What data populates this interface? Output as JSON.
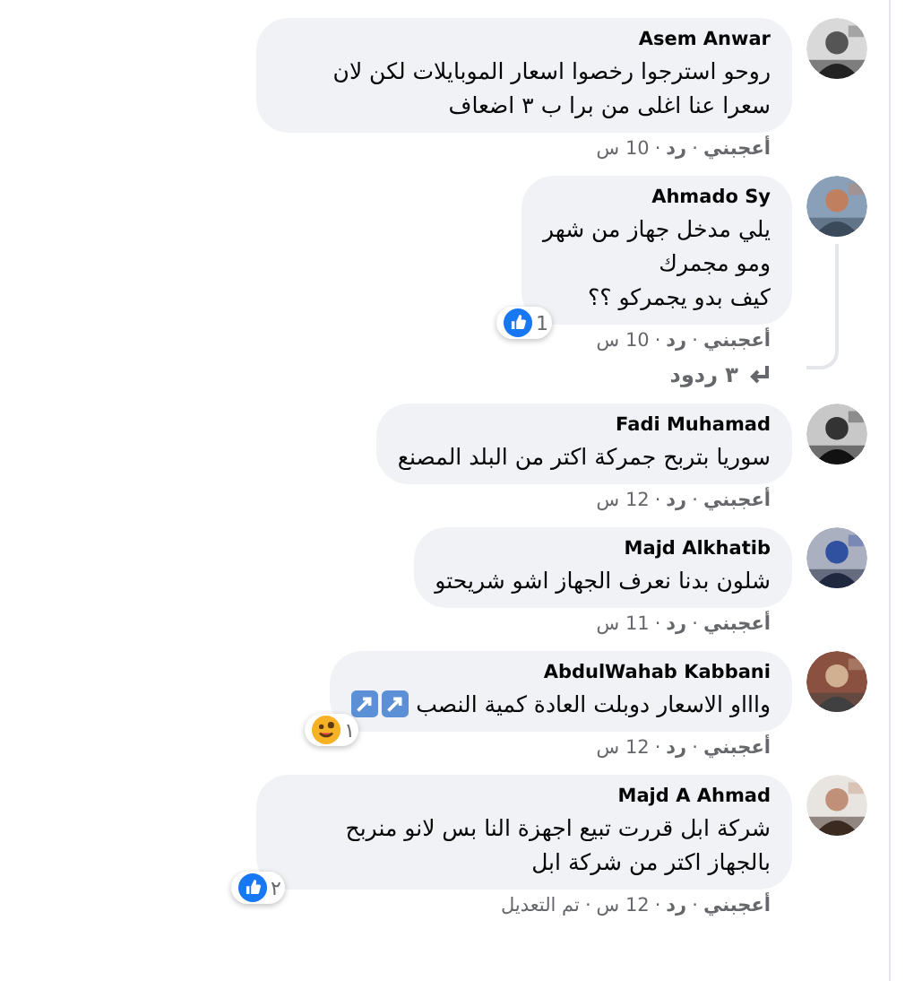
{
  "comments": [
    {
      "name": "Asem Anwar",
      "text": "روحو استرجوا رخصوا اسعار الموبايلات لكن لان سعرا عنا اغلى من برا ب ٣ اضعاف",
      "like": "أعجبني",
      "reply": "رد",
      "time": "10 س",
      "sep": "·"
    },
    {
      "name": "Ahmado Sy",
      "text": "يلي مدخل جهاز من شهر\nومو مجمرك\nكيف بدو يجمركو ؟؟",
      "like": "أعجبني",
      "reply": "رد",
      "time": "10 س",
      "sep": "·",
      "reaction": {
        "kind": "like",
        "count": "1"
      },
      "replies": "٣ ردود"
    },
    {
      "name": "Fadi Muhamad",
      "text": "سوريا بتربح جمركة اكتر من البلد المصنع",
      "like": "أعجبني",
      "reply": "رد",
      "time": "12 س",
      "sep": "·"
    },
    {
      "name": "Majd Alkhatib",
      "text": "شلون بدنا نعرف الجهاز اشو شريحتو",
      "like": "أعجبني",
      "reply": "رد",
      "time": "11 س",
      "sep": "·"
    },
    {
      "name": "AbdulWahab Kabbani",
      "text": "واااو الاسعار دوبلت العادة كمية النصب",
      "arrow_emojis": true,
      "like": "أعجبني",
      "reply": "رد",
      "time": "12 س",
      "sep": "·",
      "reaction": {
        "kind": "emoji",
        "count": "١"
      }
    },
    {
      "name": "Majd A Ahmad",
      "text": "شركة ابل قررت تبيع اجهزة النا بس لانو منربح بالجهاز اكتر من شركة ابل",
      "like": "أعجبني",
      "reply": "رد",
      "time": "12 س",
      "edited": "تم التعديل",
      "sep": "·",
      "reaction": {
        "kind": "like",
        "count": "٢"
      }
    }
  ]
}
